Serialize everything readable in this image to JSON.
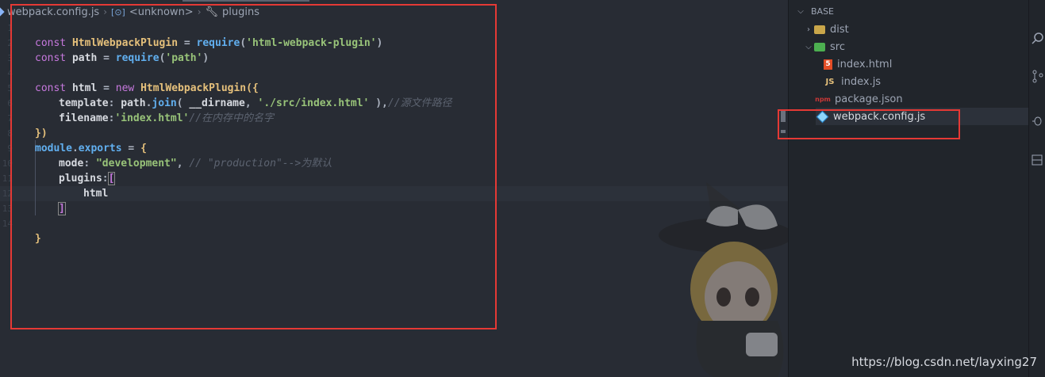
{
  "breadcrumb": {
    "file": "webpack.config.js",
    "symbol_icon": "[⊙]",
    "symbol": "<unknown>",
    "property_icon": "wrench-icon",
    "property": "plugins"
  },
  "gutter_numbers": [
    "1",
    "2",
    "3",
    "4",
    "5",
    "6",
    "7",
    "8",
    "9",
    "10",
    "11",
    "12",
    "13",
    "14"
  ],
  "code": {
    "l1": {
      "kw": "const ",
      "cls": "HtmlWebpackPlugin",
      "op": " = ",
      "fn": "require",
      "p1": "(",
      "str": "'html-webpack-plugin'",
      "p2": ")"
    },
    "l2": {
      "kw": "const ",
      "name": "path",
      "op": " = ",
      "fn": "require",
      "p1": "(",
      "str": "'path'",
      "p2": ")"
    },
    "l4": {
      "kw": "const ",
      "name": "html",
      "op": " = ",
      "new": "new ",
      "cls": "HtmlWebpackPlugin",
      "p1": "({"
    },
    "l5": {
      "prop": "template",
      "colon": ": ",
      "obj": "path",
      "dot": ".",
      "fn": "join",
      "p1": "( ",
      "dirname": "__dirname",
      "comma": ", ",
      "str": "'./src/index.html'",
      "p2": " ),",
      "cmt": "//源文件路径"
    },
    "l6": {
      "prop": "filename",
      "colon": ":",
      "str": "'index.html'",
      "cmt": "//在内存中的名字"
    },
    "l7": {
      "p": "})"
    },
    "l8": {
      "obj": "module",
      "dot": ".",
      "prop": "exports",
      "op": " = ",
      "brace": "{"
    },
    "l9": {
      "prop": "mode",
      "colon": ": ",
      "str": "\"development\"",
      "comma": ", ",
      "cmt": "// \"production\"-->为默认"
    },
    "l10": {
      "prop": "plugins",
      "colon": ":",
      "bracket": "["
    },
    "l11": {
      "name": "html"
    },
    "l12": {
      "bracket": "]"
    },
    "l14": {
      "brace": "}"
    }
  },
  "explorer": {
    "title": "BASE",
    "items": [
      {
        "label": "dist",
        "icon": "folder-icon",
        "type": "folder",
        "expanded": false
      },
      {
        "label": "src",
        "icon": "folder-src-icon",
        "type": "folder",
        "expanded": true
      },
      {
        "label": "index.html",
        "icon": "html-file-icon",
        "type": "file"
      },
      {
        "label": "index.js",
        "icon": "js-file-icon",
        "type": "file",
        "icon_text": "JS"
      },
      {
        "label": "package.json",
        "icon": "npm-file-icon",
        "type": "file",
        "icon_text": "npm"
      },
      {
        "label": "webpack.config.js",
        "icon": "webpack-file-icon",
        "type": "file",
        "active": true
      }
    ]
  },
  "watermark": "https://blog.csdn.net/layxing27",
  "colors": {
    "highlight_box": "#e53935",
    "editor_bg": "#282c34",
    "sidebar_bg": "#21252b"
  }
}
